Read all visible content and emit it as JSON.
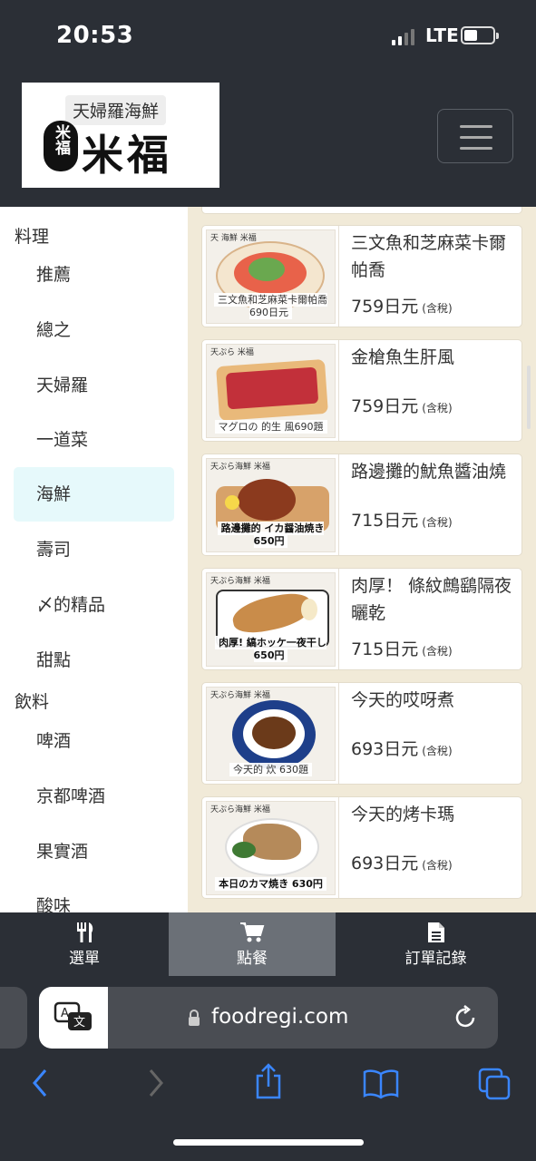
{
  "status_bar": {
    "time": "20:53",
    "network": "LTE"
  },
  "header": {
    "logo_subtitle": "天婦羅海鮮",
    "logo_seal": "米福",
    "logo_title": "米福"
  },
  "sidebar": {
    "food_heading": "料理",
    "food_items": [
      "推薦",
      "總之",
      "天婦羅",
      "一道菜",
      "海鮮",
      "壽司",
      "〆的精品",
      "甜點"
    ],
    "drink_heading": "飲料",
    "drink_items": [
      "啤酒",
      "京都啤酒",
      "果實酒",
      "酸味"
    ],
    "active_item": "海鮮"
  },
  "menu": [
    {
      "name": "三文魚和芝麻菜卡爾帕喬",
      "price": "759日元",
      "tax": "(含稅)",
      "thumb_tag": "天 海鮮 米福",
      "thumb_caption": "三文魚和芝麻菜卡爾帕喬 690日元"
    },
    {
      "name": "金槍魚生肝風",
      "price": "759日元",
      "tax": "(含稅)",
      "thumb_tag": "天ぷら 米福",
      "thumb_caption": "マグロの 的生 風690題"
    },
    {
      "name": "路邊攤的魷魚醬油燒",
      "price": "715日元",
      "tax": "(含稅)",
      "thumb_tag": "天ぷら海鮮 米福",
      "thumb_caption": "路邊攤的 イカ醤油焼き 650円"
    },
    {
      "name": "肉厚！ 條紋鷓鷂隔夜曬乾",
      "price": "715日元",
      "tax": "(含稅)",
      "thumb_tag": "天ぷら海鮮 米福",
      "thumb_caption": "肉厚! 縞ホッケ一夜干し 650円"
    },
    {
      "name": "今天的哎呀煮",
      "price": "693日元",
      "tax": "(含稅)",
      "thumb_tag": "天ぷら海鮮 米福",
      "thumb_caption": "今天的 炊 630題"
    },
    {
      "name": "今天的烤卡瑪",
      "price": "693日元",
      "tax": "(含稅)",
      "thumb_tag": "天ぷら海鮮 米福",
      "thumb_caption": "本日のカマ焼き 630円"
    }
  ],
  "bottom_nav": {
    "menu_label": "選單",
    "order_label": "點餐",
    "history_label": "訂單記錄",
    "active": "點餐"
  },
  "browser": {
    "url": "foodregi.com",
    "icons": [
      "translate-icon",
      "lock-icon",
      "reload-icon",
      "back-icon",
      "forward-icon",
      "share-icon",
      "bookmarks-icon",
      "tabs-icon"
    ]
  },
  "colors": {
    "dark": "#2b2f36",
    "content_bg": "#f1ead8",
    "active_cat": "#e6f9fb",
    "active_nav": "#6b7077",
    "safari_blue": "#3a86ff"
  }
}
